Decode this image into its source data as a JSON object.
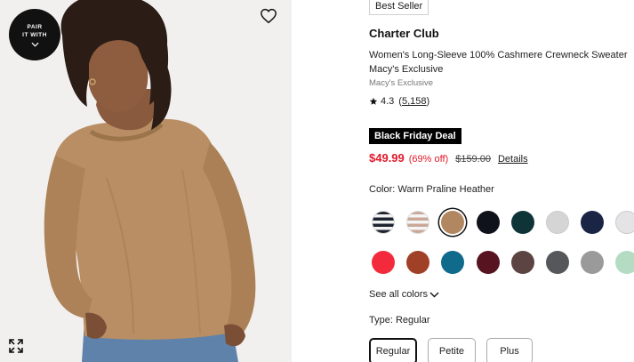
{
  "image": {
    "pair_badge_line1": "PAIR",
    "pair_badge_line2": "IT WITH",
    "heart_icon": "heart-outline-icon",
    "expand_icon": "expand-arrows-icon"
  },
  "badge": "Best Seller",
  "brand": "Charter Club",
  "title": "Women's Long-Sleeve 100% Cashmere Crewneck Sweater",
  "exclusive": "Macy's Exclusive",
  "sub_brand": "Macy's Exclusive",
  "rating": {
    "value": "4.3",
    "open_paren": "(",
    "count": "5,158",
    "close_paren": ")"
  },
  "deal": "Black Friday Deal",
  "price": {
    "sale": "$49.99",
    "percent_off": "(69% off)",
    "original": "$159.00",
    "details_link": "Details"
  },
  "color": {
    "label": "Color: Warm Praline Heather",
    "swatches": [
      {
        "name": "black-white-stripe",
        "color": "#1e2430",
        "pattern": "stripe",
        "stripe_color": "#f3f3f3"
      },
      {
        "name": "tan-white-stripe",
        "color": "#c9a898",
        "pattern": "stripe",
        "stripe_color": "#f5f5f5"
      },
      {
        "name": "warm-praline-heather",
        "color": "#b18762",
        "pattern": "solid",
        "selected": true
      },
      {
        "name": "black",
        "color": "#0f121a",
        "pattern": "solid"
      },
      {
        "name": "dark-teal",
        "color": "#0f3438",
        "pattern": "solid"
      },
      {
        "name": "light-grey",
        "color": "#d5d5d5",
        "pattern": "solid"
      },
      {
        "name": "navy",
        "color": "#1a2545",
        "pattern": "solid"
      },
      {
        "name": "pale-grey",
        "color": "#e4e4e6",
        "pattern": "solid"
      },
      {
        "name": "red",
        "color": "#f22a3c",
        "pattern": "solid"
      },
      {
        "name": "rust",
        "color": "#a04027",
        "pattern": "solid"
      },
      {
        "name": "teal-blue",
        "color": "#0f6a8c",
        "pattern": "solid"
      },
      {
        "name": "burgundy",
        "color": "#571320",
        "pattern": "solid"
      },
      {
        "name": "brown",
        "color": "#5c4443",
        "pattern": "solid"
      },
      {
        "name": "charcoal",
        "color": "#55575b",
        "pattern": "solid"
      },
      {
        "name": "medium-grey",
        "color": "#9a9a9a",
        "pattern": "solid"
      },
      {
        "name": "mint",
        "color": "#b4dcc3",
        "pattern": "solid"
      }
    ],
    "see_all": "See all colors"
  },
  "type": {
    "label": "Type: Regular",
    "options": [
      {
        "label": "Regular",
        "selected": true
      },
      {
        "label": "Petite",
        "selected": false
      },
      {
        "label": "Plus",
        "selected": false
      }
    ]
  },
  "colors": {
    "sale_red": "#e11a2b",
    "deal_bg": "#000000",
    "image_bg": "#f0f0f0"
  }
}
